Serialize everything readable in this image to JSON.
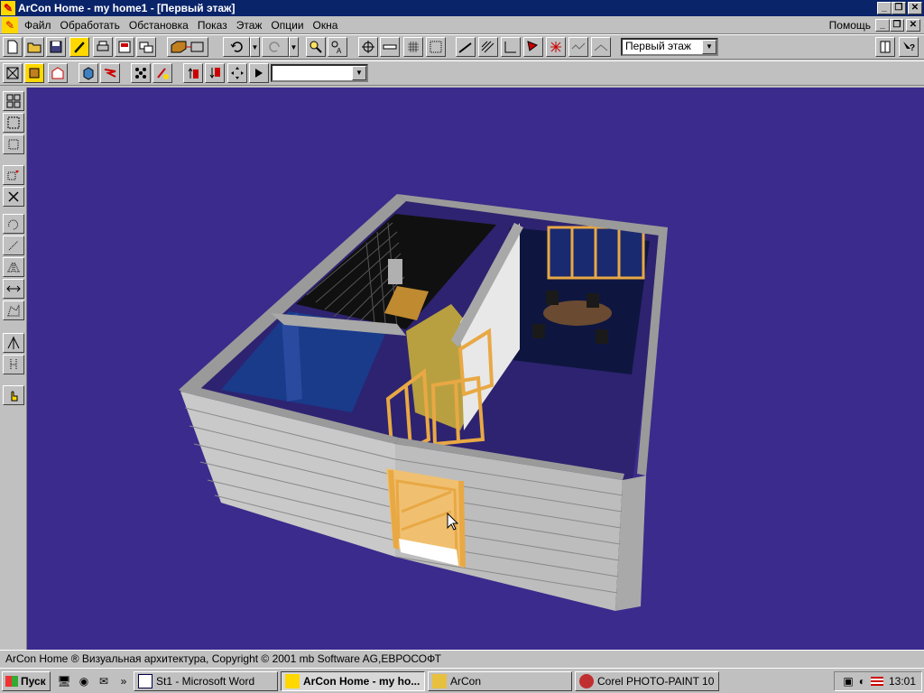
{
  "window": {
    "title": "ArCon  Home - my home1 - [Первый этаж]"
  },
  "menu": {
    "items": [
      "Файл",
      "Обработать",
      "Обстановка",
      "Показ",
      "Этаж",
      "Опции",
      "Окна"
    ],
    "help": "Помощь"
  },
  "toolbar": {
    "floor_select": "Первый этаж",
    "second_select": ""
  },
  "status": {
    "text": "ArCon Home ® Визуальная архитектура, Copyright © 2001 mb Software AG,ЕВРОСОФТ"
  },
  "taskbar": {
    "start_label": "Пуск",
    "tasks": [
      {
        "label": "St1 - Microsoft Word"
      },
      {
        "label": "ArCon  Home - my ho..."
      },
      {
        "label": "ArCon"
      },
      {
        "label": "Corel PHOTO-PAINT 10"
      }
    ],
    "clock": "13:01",
    "more": "»"
  },
  "colors": {
    "title_bg": "#0a246a",
    "viewport_bg": "#3a2b8c",
    "brick": "#c9c9c9",
    "wood": "#e8a844",
    "room_blue": "#1a3a8a"
  }
}
